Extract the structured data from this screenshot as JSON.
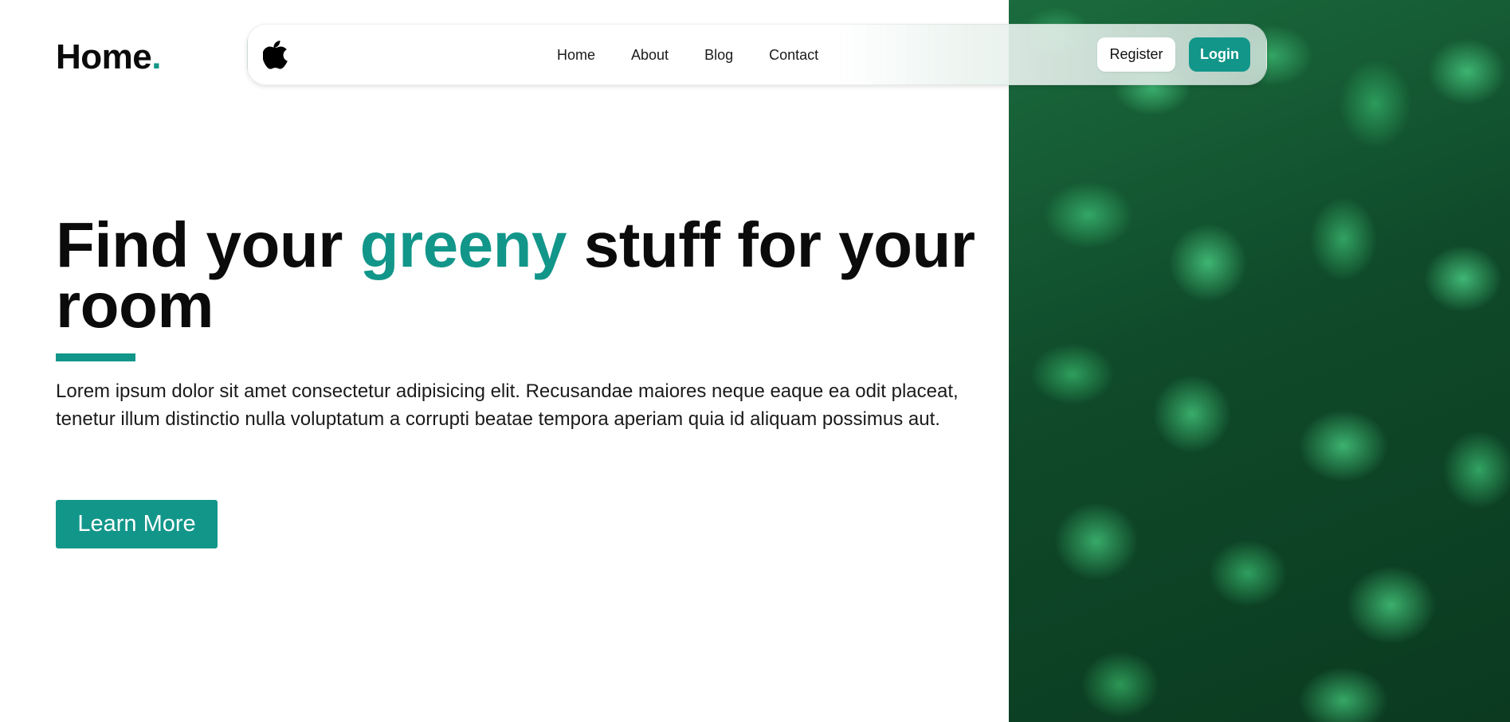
{
  "brand": {
    "name": "Home",
    "dot": "."
  },
  "navbar": {
    "logo_icon": "apple-icon",
    "links": [
      {
        "label": "Home"
      },
      {
        "label": "About"
      },
      {
        "label": "Blog"
      },
      {
        "label": "Contact"
      }
    ],
    "register_label": "Register",
    "login_label": "Login"
  },
  "hero": {
    "title_before": "Find your ",
    "title_accent": "greeny",
    "title_after": " stuff for your room",
    "description": "Lorem ipsum dolor sit amet consectetur adipisicing elit. Recusandae maiores neque eaque ea odit placeat, tenetur illum distinctio nulla voluptatum a corrupti beatae tempora aperiam quia id aliquam possimus aut.",
    "cta_label": "Learn More"
  },
  "colors": {
    "accent": "#12968a",
    "text": "#0b0b0b",
    "background": "#ffffff"
  }
}
